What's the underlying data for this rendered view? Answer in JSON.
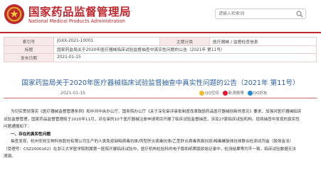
{
  "header": {
    "title": "国家药品监督管理局",
    "subtitle": "National Medical Products Administration",
    "search_placeholder": "请输入检索词",
    "colors": {
      "brand": "#c0262c",
      "link": "#2a5fa8"
    }
  },
  "info": {
    "rows": [
      {
        "label": "索引号",
        "value": "JGXX-2021-10001",
        "label2": "主题分类",
        "value2": "医疗器械 / 监督检查信息"
      },
      {
        "label": "标题",
        "value": "国家药监局关于2020年医疗器械临床试验监督抽查中真实性问题的公告（2021年 第11号）"
      },
      {
        "label": "发布日期",
        "value": "2021-01-15"
      }
    ]
  },
  "article": {
    "title": "国家药监局关于2020年医疗器械临床试验监督抽查中真实性问题的公告（2021年 第11号）",
    "date": "2021-01-15",
    "share": {
      "qzone": "QQ空间",
      "weibo": "新浪微博",
      "qq": "QQ好友"
    },
    "paragraphs": [
      "为切实贯彻落实《医疗器械监督管理条例》和中共中央办公厅、国务院办公厅《关于深化审评审批制度改革鼓励药品医疗器械创新的意见》要求，加强对医疗器械临床",
      "试验监督管理，国家药品监督管理局于2020年11月，对在审的10个医疗器械注册申请项目开展了临床试验监督抽查，涉及27家临床试验机构。现将抽查中发现的真实性",
      "问题通报如下："
    ],
    "section1": "一、存在的真实性问题",
    "paragraphs2": [
      "抽查发现，杭州安旭生物科技股份有限公司生产的人类免疫缺陷病毒抗体/丙型肝炎病毒抗体/乙型肝炎病毒表面抗原/梅毒螺旋体抗体联合检测试剂盒（胶体金法）",
      "（受理号：CSZ2000162）在浙江大学医学院附属第一医院开展临床试验中，医疗机构检验科的电子版和纸质版原始记录中，检测结果等均不一致，临床试验数据无法",
      "溯源。"
    ]
  }
}
